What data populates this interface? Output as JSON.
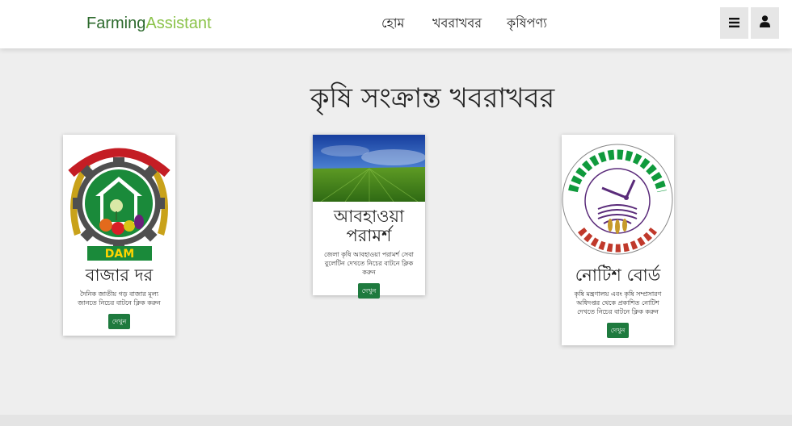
{
  "navbar": {
    "brand_part1": "Farming",
    "brand_part2": "Assistant",
    "links": [
      "হোম",
      "খবরাখবর",
      "কৃষিপণ্য"
    ],
    "menu_icon": "hamburger-icon",
    "user_icon": "user-icon"
  },
  "page_title": "কৃষি সংক্রান্ত খবরাখবর",
  "cards": [
    {
      "logo_label": "DAM",
      "title": "বাজার দর",
      "text": "দৈনিক জাতীয় গড় বাজার মূল্য জানতে নিচের বাটনে ক্লিক করুন",
      "button": "দেখুন"
    },
    {
      "title": "আবহাওয়া পরামর্শ",
      "text": "জেলা কৃষি আবহাওয়া পরামর্শ সেবা বুলেটিন দেখতে নিচের বাটনে ক্লিক করুন",
      "button": "দেখুন"
    },
    {
      "title": "নোটিশ বোর্ড",
      "text": "কৃষি মন্ত্রণালয় এবং কৃষি সম্প্রসারণ অধিদপ্তর থেকে প্রকাশিত নোটিশ দেখতে নিচের বাটনে ক্লিক করুন",
      "button": "দেখুন"
    }
  ]
}
